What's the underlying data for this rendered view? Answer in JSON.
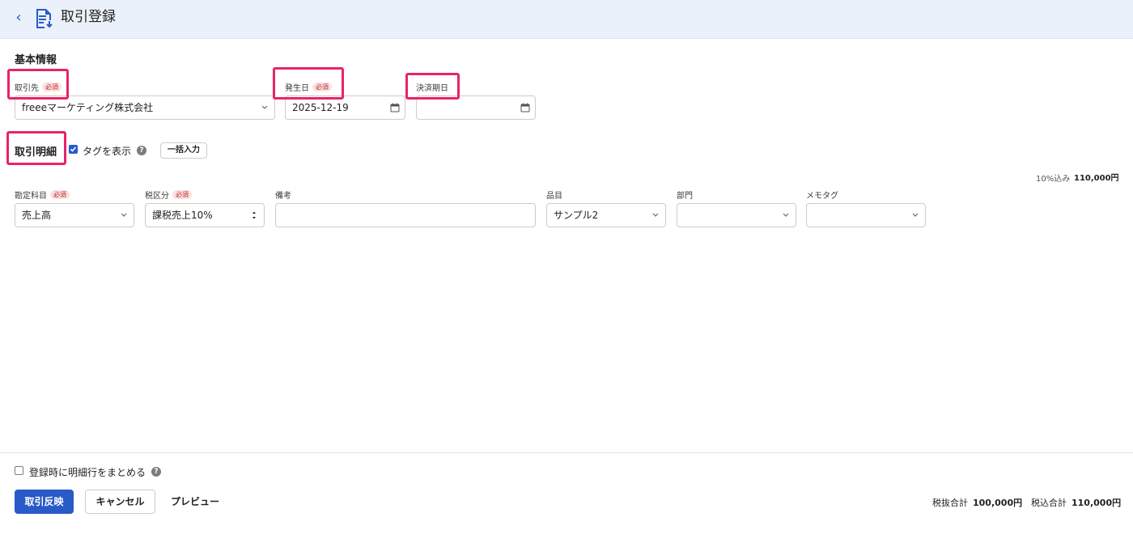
{
  "header": {
    "back_label": "‹",
    "title": "取引登録"
  },
  "basic": {
    "section_title": "基本情報",
    "required_badge": "必須",
    "partner": {
      "label": "取引先",
      "value": "freeeマーケティング株式会社"
    },
    "issue_date": {
      "label": "発生日",
      "value": "2025-12-19"
    },
    "due_date": {
      "label": "決済期日",
      "value": ""
    }
  },
  "details": {
    "section_title": "取引明細",
    "show_tags_label": "タグを表示",
    "show_tags_checked": true,
    "help_glyph": "?",
    "bulk_input_label": "一括入力",
    "tax_note_label": "10%込み",
    "tax_note_value": "110,000円",
    "columns": {
      "account": {
        "label": "勘定科目",
        "value": "売上高"
      },
      "tax": {
        "label": "税区分",
        "value": "課税売上10%"
      },
      "memo": {
        "label": "備考",
        "value": ""
      },
      "item": {
        "label": "品目",
        "value": "サンプル2"
      },
      "department": {
        "label": "部門",
        "value": ""
      },
      "memo_tag": {
        "label": "メモタグ",
        "value": ""
      }
    }
  },
  "footer": {
    "merge_label": "登録時に明細行をまとめる",
    "merge_checked": false,
    "submit_label": "取引反映",
    "cancel_label": "キャンセル",
    "preview_label": "プレビュー",
    "total_excl_label": "税抜合計",
    "total_excl_value": "100,000円",
    "total_incl_label": "税込合計",
    "total_incl_value": "110,000円"
  },
  "colors": {
    "accent": "#285ac8",
    "highlight": "#e8246a",
    "header_bg": "#eaf1fb",
    "required_bg": "#fbe1e1",
    "required_text": "#bd2a2a"
  }
}
